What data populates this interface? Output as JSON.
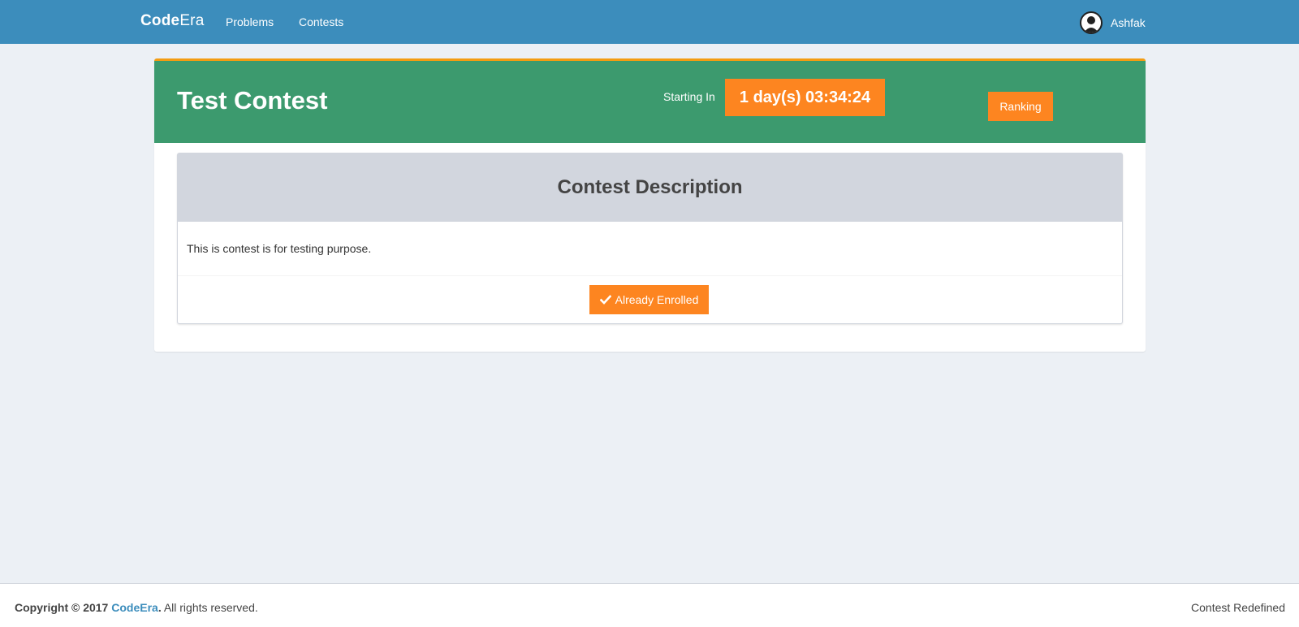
{
  "navbar": {
    "brand_bold": "Code",
    "brand_light": "Era",
    "links": {
      "problems": "Problems",
      "contests": "Contests"
    },
    "user_name": "Ashfak",
    "color": "#3c8dbc"
  },
  "contest": {
    "title": "Test Contest",
    "starting_label": "Starting In",
    "countdown": "1 day(s) 03:34:24",
    "ranking_label": "Ranking",
    "header_color": "#3c9a6e",
    "accent_color": "#fd8520"
  },
  "description": {
    "heading": "Contest Description",
    "body": "This is contest is for testing purpose.",
    "enroll_label": "Already Enrolled",
    "enroll_icon": "check-icon"
  },
  "footer": {
    "copyright_prefix": "Copyright © 2017 ",
    "brand_link": "CodeEra",
    "period": ".",
    "rights": " All rights reserved.",
    "tagline": "Contest Redefined"
  }
}
